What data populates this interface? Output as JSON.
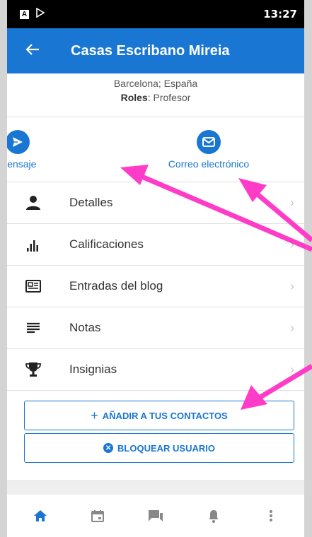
{
  "status_bar": {
    "time": "13:27",
    "left_icon": "A"
  },
  "appbar": {
    "title": "Casas Escribano Mireia"
  },
  "profile": {
    "location": "Barcelona; España",
    "roles_label": "Roles",
    "roles_value": ": Profesor"
  },
  "actions": [
    {
      "label": "Mensaje",
      "icon": "send-icon"
    },
    {
      "label": "Correo electrónico",
      "icon": "mail-icon"
    }
  ],
  "menu": [
    {
      "label": "Detalles",
      "icon": "person-icon"
    },
    {
      "label": "Calificaciones",
      "icon": "bar-chart-icon"
    },
    {
      "label": "Entradas del blog",
      "icon": "news-icon"
    },
    {
      "label": "Notas",
      "icon": "notes-icon"
    },
    {
      "label": "Insignias",
      "icon": "trophy-icon"
    }
  ],
  "buttons": {
    "add_contacts": "AÑADIR A TUS CONTACTOS",
    "block_user": "BLOQUEAR USUARIO"
  },
  "bottom_nav": [
    "home-icon",
    "calendar-icon",
    "messages-icon",
    "bell-icon",
    "more-icon"
  ],
  "colors": {
    "accent": "#1976d2",
    "annotation": "#ff3cc7"
  }
}
